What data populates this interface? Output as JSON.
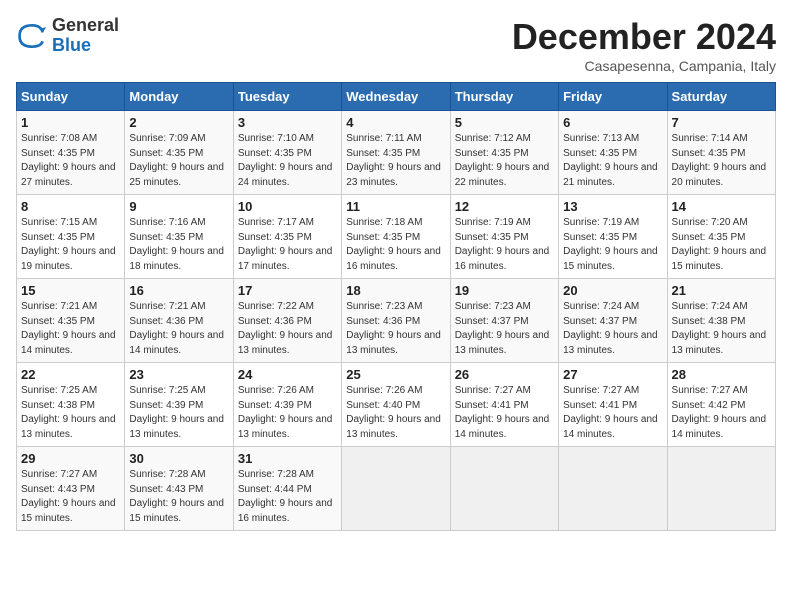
{
  "logo": {
    "general": "General",
    "blue": "Blue"
  },
  "title": "December 2024",
  "subtitle": "Casapesenna, Campania, Italy",
  "days_of_week": [
    "Sunday",
    "Monday",
    "Tuesday",
    "Wednesday",
    "Thursday",
    "Friday",
    "Saturday"
  ],
  "weeks": [
    [
      {
        "day": "1",
        "sunrise": "7:08 AM",
        "sunset": "4:35 PM",
        "daylight": "9 hours and 27 minutes."
      },
      {
        "day": "2",
        "sunrise": "7:09 AM",
        "sunset": "4:35 PM",
        "daylight": "9 hours and 25 minutes."
      },
      {
        "day": "3",
        "sunrise": "7:10 AM",
        "sunset": "4:35 PM",
        "daylight": "9 hours and 24 minutes."
      },
      {
        "day": "4",
        "sunrise": "7:11 AM",
        "sunset": "4:35 PM",
        "daylight": "9 hours and 23 minutes."
      },
      {
        "day": "5",
        "sunrise": "7:12 AM",
        "sunset": "4:35 PM",
        "daylight": "9 hours and 22 minutes."
      },
      {
        "day": "6",
        "sunrise": "7:13 AM",
        "sunset": "4:35 PM",
        "daylight": "9 hours and 21 minutes."
      },
      {
        "day": "7",
        "sunrise": "7:14 AM",
        "sunset": "4:35 PM",
        "daylight": "9 hours and 20 minutes."
      }
    ],
    [
      {
        "day": "8",
        "sunrise": "7:15 AM",
        "sunset": "4:35 PM",
        "daylight": "9 hours and 19 minutes."
      },
      {
        "day": "9",
        "sunrise": "7:16 AM",
        "sunset": "4:35 PM",
        "daylight": "9 hours and 18 minutes."
      },
      {
        "day": "10",
        "sunrise": "7:17 AM",
        "sunset": "4:35 PM",
        "daylight": "9 hours and 17 minutes."
      },
      {
        "day": "11",
        "sunrise": "7:18 AM",
        "sunset": "4:35 PM",
        "daylight": "9 hours and 16 minutes."
      },
      {
        "day": "12",
        "sunrise": "7:19 AM",
        "sunset": "4:35 PM",
        "daylight": "9 hours and 16 minutes."
      },
      {
        "day": "13",
        "sunrise": "7:19 AM",
        "sunset": "4:35 PM",
        "daylight": "9 hours and 15 minutes."
      },
      {
        "day": "14",
        "sunrise": "7:20 AM",
        "sunset": "4:35 PM",
        "daylight": "9 hours and 15 minutes."
      }
    ],
    [
      {
        "day": "15",
        "sunrise": "7:21 AM",
        "sunset": "4:35 PM",
        "daylight": "9 hours and 14 minutes."
      },
      {
        "day": "16",
        "sunrise": "7:21 AM",
        "sunset": "4:36 PM",
        "daylight": "9 hours and 14 minutes."
      },
      {
        "day": "17",
        "sunrise": "7:22 AM",
        "sunset": "4:36 PM",
        "daylight": "9 hours and 13 minutes."
      },
      {
        "day": "18",
        "sunrise": "7:23 AM",
        "sunset": "4:36 PM",
        "daylight": "9 hours and 13 minutes."
      },
      {
        "day": "19",
        "sunrise": "7:23 AM",
        "sunset": "4:37 PM",
        "daylight": "9 hours and 13 minutes."
      },
      {
        "day": "20",
        "sunrise": "7:24 AM",
        "sunset": "4:37 PM",
        "daylight": "9 hours and 13 minutes."
      },
      {
        "day": "21",
        "sunrise": "7:24 AM",
        "sunset": "4:38 PM",
        "daylight": "9 hours and 13 minutes."
      }
    ],
    [
      {
        "day": "22",
        "sunrise": "7:25 AM",
        "sunset": "4:38 PM",
        "daylight": "9 hours and 13 minutes."
      },
      {
        "day": "23",
        "sunrise": "7:25 AM",
        "sunset": "4:39 PM",
        "daylight": "9 hours and 13 minutes."
      },
      {
        "day": "24",
        "sunrise": "7:26 AM",
        "sunset": "4:39 PM",
        "daylight": "9 hours and 13 minutes."
      },
      {
        "day": "25",
        "sunrise": "7:26 AM",
        "sunset": "4:40 PM",
        "daylight": "9 hours and 13 minutes."
      },
      {
        "day": "26",
        "sunrise": "7:27 AM",
        "sunset": "4:41 PM",
        "daylight": "9 hours and 14 minutes."
      },
      {
        "day": "27",
        "sunrise": "7:27 AM",
        "sunset": "4:41 PM",
        "daylight": "9 hours and 14 minutes."
      },
      {
        "day": "28",
        "sunrise": "7:27 AM",
        "sunset": "4:42 PM",
        "daylight": "9 hours and 14 minutes."
      }
    ],
    [
      {
        "day": "29",
        "sunrise": "7:27 AM",
        "sunset": "4:43 PM",
        "daylight": "9 hours and 15 minutes."
      },
      {
        "day": "30",
        "sunrise": "7:28 AM",
        "sunset": "4:43 PM",
        "daylight": "9 hours and 15 minutes."
      },
      {
        "day": "31",
        "sunrise": "7:28 AM",
        "sunset": "4:44 PM",
        "daylight": "9 hours and 16 minutes."
      },
      null,
      null,
      null,
      null
    ]
  ]
}
